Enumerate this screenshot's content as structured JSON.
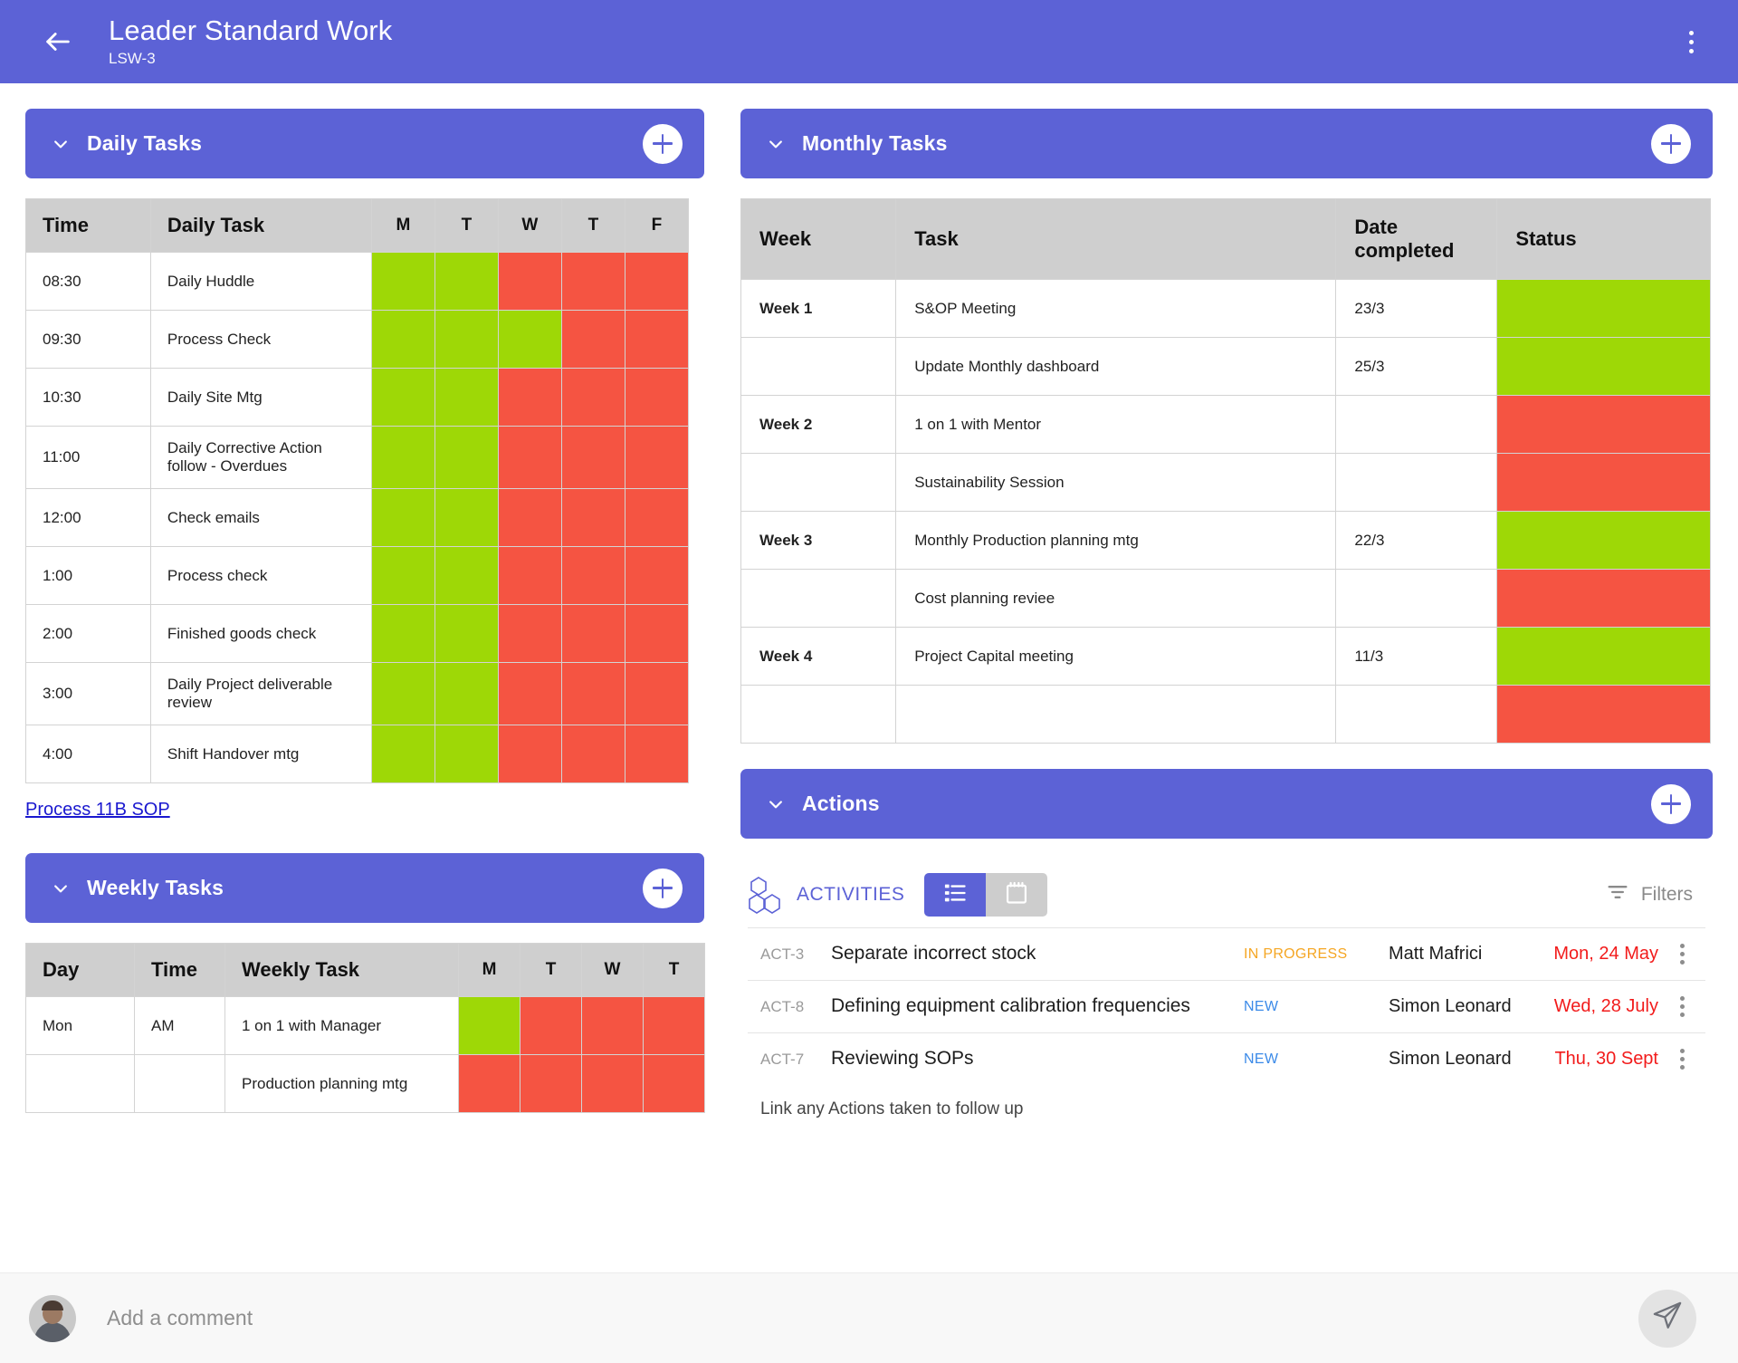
{
  "appbar": {
    "back_icon": "arrow-left-icon",
    "title": "Leader Standard Work",
    "subtitle": "LSW-3",
    "menu_icon": "kebab-menu-icon"
  },
  "daily": {
    "band_title": "Daily Tasks",
    "add_label": "+",
    "columns": [
      "Time",
      "Daily Task",
      "M",
      "T",
      "W",
      "T",
      "F"
    ],
    "rows": [
      {
        "time": "08:30",
        "task": "Daily Huddle",
        "marks": [
          "green",
          "green",
          "red",
          "red",
          "red"
        ]
      },
      {
        "time": "09:30",
        "task": "Process Check",
        "marks": [
          "green",
          "green",
          "green",
          "red",
          "red"
        ]
      },
      {
        "time": "10:30",
        "task": "Daily Site Mtg",
        "marks": [
          "green",
          "green",
          "red",
          "red",
          "red"
        ]
      },
      {
        "time": "11:00",
        "task": "Daily Corrective Action follow - Overdues",
        "marks": [
          "green",
          "green",
          "red",
          "red",
          "red"
        ]
      },
      {
        "time": "12:00",
        "task": "Check emails",
        "marks": [
          "green",
          "green",
          "red",
          "red",
          "red"
        ]
      },
      {
        "time": "1:00",
        "task": "Process check",
        "marks": [
          "green",
          "green",
          "red",
          "red",
          "red"
        ]
      },
      {
        "time": "2:00",
        "task": "Finished goods check",
        "marks": [
          "green",
          "green",
          "red",
          "red",
          "red"
        ]
      },
      {
        "time": "3:00",
        "task": "Daily Project deliverable review",
        "marks": [
          "green",
          "green",
          "red",
          "red",
          "red"
        ]
      },
      {
        "time": "4:00",
        "task": "Shift Handover mtg",
        "marks": [
          "green",
          "green",
          "red",
          "red",
          "red"
        ]
      }
    ],
    "sop_link": "Process 11B SOP"
  },
  "weekly": {
    "band_title": "Weekly Tasks",
    "add_label": "+",
    "columns": [
      "Day",
      "Time",
      "Weekly Task",
      "M",
      "T",
      "W",
      "T"
    ],
    "rows": [
      {
        "day": "Mon",
        "time": "AM",
        "task": "1 on 1 with Manager",
        "marks": [
          "green",
          "red",
          "red",
          "red"
        ]
      },
      {
        "day": "",
        "time": "",
        "task": "Production planning mtg",
        "marks": [
          "red",
          "red",
          "red",
          "red"
        ]
      }
    ]
  },
  "monthly": {
    "band_title": "Monthly Tasks",
    "add_label": "+",
    "columns": [
      "Week",
      "Task",
      "Date completed",
      "Status"
    ],
    "rows": [
      {
        "week": "Week 1",
        "task": "S&OP Meeting",
        "date": "23/3",
        "status": "green"
      },
      {
        "week": "",
        "task": "Update Monthly dashboard",
        "date": "25/3",
        "status": "green"
      },
      {
        "week": "Week 2",
        "task": "1 on 1 with Mentor",
        "date": "",
        "status": "red"
      },
      {
        "week": "",
        "task": "Sustainability Session",
        "date": "",
        "status": "red"
      },
      {
        "week": "Week 3",
        "task": "Monthly Production planning mtg",
        "date": "22/3",
        "status": "green"
      },
      {
        "week": "",
        "task": "Cost planning reviee",
        "date": "",
        "status": "red"
      },
      {
        "week": "Week 4",
        "task": "Project Capital meeting",
        "date": "11/3",
        "status": "green"
      },
      {
        "week": "",
        "task": "",
        "date": "",
        "status": "red"
      }
    ]
  },
  "actions": {
    "band_title": "Actions",
    "add_label": "+",
    "toolbar": {
      "hex_icon": "activities-hex-icon",
      "label": "ACTIVITIES",
      "list_view_icon": "list-view-icon",
      "calendar_view_icon": "calendar-view-icon",
      "filters_icon": "filter-icon",
      "filters_label": "Filters"
    },
    "items": [
      {
        "id": "ACT-3",
        "title": "Separate incorrect stock",
        "status": "IN PROGRESS",
        "status_color": "#f5a623",
        "owner": "Matt Mafrici",
        "due": "Mon, 24 May",
        "due_color": "#f21b1b"
      },
      {
        "id": "ACT-8",
        "title": "Defining equipment calibration frequencies",
        "status": "NEW",
        "status_color": "#3b8ae8",
        "owner": "Simon Leonard",
        "due": "Wed, 28 July",
        "due_color": "#f21b1b"
      },
      {
        "id": "ACT-7",
        "title": "Reviewing SOPs",
        "status": "NEW",
        "status_color": "#3b8ae8",
        "owner": "Simon Leonard",
        "due": "Thu, 30 Sept",
        "due_color": "#f21b1b"
      }
    ],
    "footnote": "Link any Actions taken to follow up"
  },
  "comment_bar": {
    "avatar": "user-avatar",
    "placeholder": "Add a comment",
    "send_icon": "send-icon"
  },
  "colors": {
    "brand": "#5c62d6",
    "green": "#9ed806",
    "red": "#f55442",
    "header_grey": "#cfcfcf",
    "link_blue": "#1a18cf"
  }
}
